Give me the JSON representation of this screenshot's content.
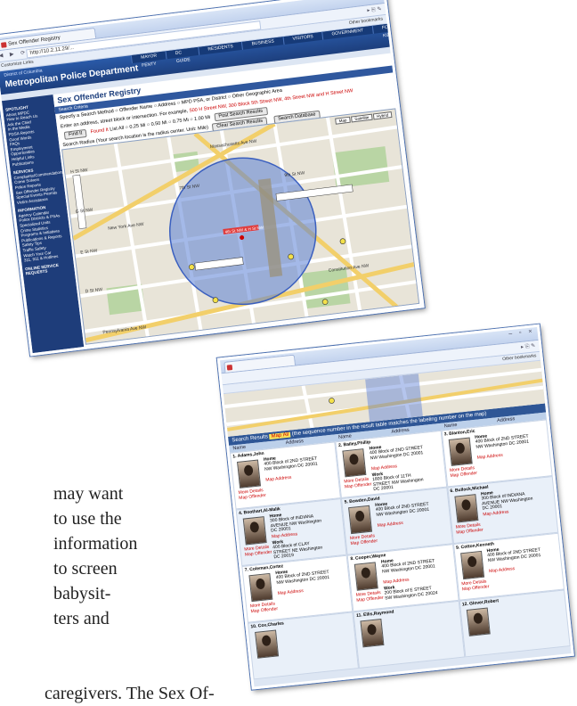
{
  "window_top": {
    "tab_title": "Sex Offender Registry",
    "url": "http://10.2.11.29/...",
    "bookmarks_left": "Customize Links",
    "bookmarks_right": "Other bookmarks",
    "site_top": "District of Columbia",
    "site_title": "Metropolitan Police Department",
    "nav": [
      "MAYOR FENTY",
      "DC GUIDE",
      "RESIDENTS",
      "BUSINESS",
      "VISITORS",
      "GOVERNMENT",
      "FOR KIDS"
    ],
    "sidebar_sections": [
      {
        "heading": "SPOTLIGHT",
        "items": [
          "About MPDC",
          "How to Reach Us",
          "Ask the Chief",
          "In the Media",
          "PDSA Reports",
          "Good Words",
          "FAQs",
          "Employment Opportunities",
          "Helpful Links",
          "Publications"
        ]
      },
      {
        "heading": "SERVICES",
        "items": [
          "Complaints/Commendations",
          "Crime Solvers",
          "Police Reports",
          "Sex Offender Registry",
          "Special Events Permits",
          "Victim Assistance"
        ]
      },
      {
        "heading": "INFORMATION",
        "items": [
          "Agency Calendar",
          "Police Districts & PSAs",
          "Specialized Units",
          "Crime Statistics",
          "Programs & Initiatives",
          "Publications & Reports",
          "Safety Tips",
          "Traffic Safety",
          "Watch Your Car",
          "311, 911 & Hotlines"
        ]
      },
      {
        "heading": "ONLINE SERVICE REQUESTS",
        "items": []
      }
    ],
    "page_title": "Sex Offender Registry",
    "criteria_label": "Search Criteria",
    "specify_label": "Specify a Search Method",
    "search_methods": [
      "Offender Name",
      "Address",
      "MPD PSA, or District",
      "Other Geographic Area"
    ],
    "enter_address_text": "Enter an address, street block or intersection. For example,",
    "example_text": "500 H Street NW, 300 Block 5th Street NW, 4th Street NW and H Street NW",
    "find_button": "Find It",
    "found_text": "Found It",
    "list_all": "List All",
    "radius_label": "Search Radius (Your search location is the radius center. Unit: Mile)",
    "radius_options": [
      "0.25 Mi",
      "0.50 Mi",
      "0.75 Mi",
      "1.00 Mi"
    ],
    "post_search": "Post Search Results",
    "search_db": "Search Database",
    "clear_results": "Clear Search Results",
    "map_types": [
      "Map",
      "Satellite",
      "Hybrid"
    ],
    "map_streets": [
      "Constitution Ave NW",
      "Pennsylvania Ave NW",
      "Massachusetts Ave NW",
      "New York Ave NW",
      "H St NW",
      "E St NW",
      "G St NW",
      "D St NW",
      "7th St NW",
      "9th St NW"
    ],
    "map_label": "4th St NW & H St NW"
  },
  "window_bottom": {
    "results_title": "Search Results",
    "map_all": "Map All",
    "results_note": "(the sequence number in the result table matches the labeling number on the map)",
    "col_headers": [
      "Name",
      "Address",
      "Name",
      "Address",
      "Name",
      "Address"
    ],
    "offenders": [
      {
        "num": "1.",
        "name": "Adams,John",
        "home": "400 Block of 2ND STREET NW Washington DC 20001",
        "work": ""
      },
      {
        "num": "2.",
        "name": "Bailey,Phillip",
        "home": "400 Block of 2ND STREET NW Washington DC 20001",
        "work": "1800 Block of 11TH STREET NW Washington DC 20001"
      },
      {
        "num": "3.",
        "name": "Blanton,Eric",
        "home": "400 Block of 2ND STREET NW Washington DC 20001",
        "work": ""
      },
      {
        "num": "4.",
        "name": "Boothart,Al-Malik",
        "home": "300 Block of INDIANA AVENUE NW Washington DC 20001",
        "work": "400 Block of CLAY STREET NE Washington DC 20019"
      },
      {
        "num": "5.",
        "name": "Bowden,David",
        "home": "400 Block of 2ND STREET NW Washington DC 20001",
        "work": ""
      },
      {
        "num": "6.",
        "name": "Bullock,Michael",
        "home": "300 Block of INDIANA AVENUE NW Washington DC 20001",
        "work": ""
      },
      {
        "num": "7.",
        "name": "Coleman,Cortez",
        "home": "400 Block of 2ND STREET NW Washington DC 20001",
        "work": ""
      },
      {
        "num": "8.",
        "name": "Cooper,Wayne",
        "home": "400 Block of 2ND STREET NW Washington DC 20001",
        "work": "200 Block of E STREET SW Washington DC 20024"
      },
      {
        "num": "9.",
        "name": "Cotton,Kenneth",
        "home": "400 Block of 2ND STREET NW Washington DC 20001",
        "work": ""
      },
      {
        "num": "10.",
        "name": "Cox,Charles",
        "home": "",
        "work": ""
      },
      {
        "num": "11.",
        "name": "Ellis,Raymond",
        "home": "",
        "work": ""
      },
      {
        "num": "12.",
        "name": "Glover,Robert",
        "home": "",
        "work": ""
      }
    ],
    "home_label": "Home",
    "work_label": "Work",
    "more_details": "More Details",
    "map_offender": "Map Offender",
    "map_address": "Map Address"
  },
  "body_lines": [
    "may want",
    "to use the",
    "information",
    "to screen",
    "babysit-",
    "ters and"
  ],
  "body_last": "caregivers. The Sex Of-",
  "colors": {
    "accent": "#1d3f7d",
    "link_red": "#c00000",
    "radius_fill": "#5a7fd6"
  }
}
